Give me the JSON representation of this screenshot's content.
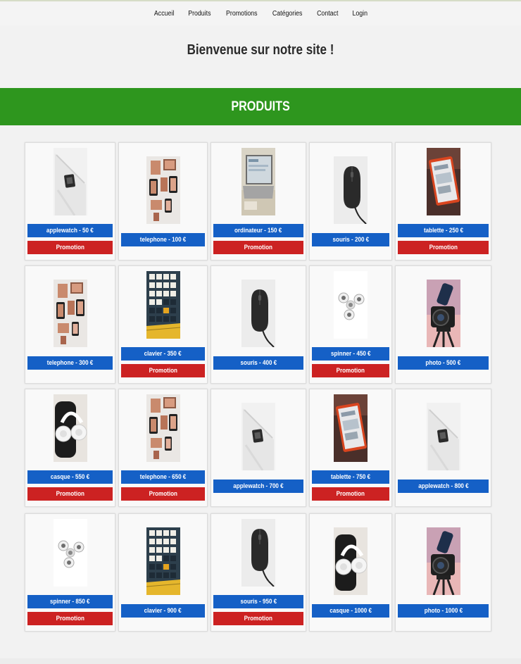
{
  "nav": {
    "items": [
      "Accueil",
      "Produits",
      "Promotions",
      "Catégories",
      "Contact",
      "Login"
    ]
  },
  "welcome": "Bienvenue sur notre site !",
  "banner": "PRODUITS",
  "products": [
    {
      "label": "applewatch - 50 €",
      "image": "applewatch",
      "promo": "Promotion"
    },
    {
      "label": "telephone - 100 €",
      "image": "telephone",
      "promo": ""
    },
    {
      "label": "ordinateur - 150 €",
      "image": "ordinateur",
      "promo": "Promotion"
    },
    {
      "label": "souris - 200 €",
      "image": "souris",
      "promo": ""
    },
    {
      "label": "tablette - 250 €",
      "image": "tablette",
      "promo": "Promotion"
    },
    {
      "label": "telephone - 300 €",
      "image": "telephone",
      "promo": ""
    },
    {
      "label": "clavier - 350 €",
      "image": "clavier",
      "promo": "Promotion"
    },
    {
      "label": "souris - 400 €",
      "image": "souris",
      "promo": ""
    },
    {
      "label": "spinner - 450 €",
      "image": "spinner",
      "promo": "Promotion"
    },
    {
      "label": "photo - 500 €",
      "image": "photo",
      "promo": ""
    },
    {
      "label": "casque - 550 €",
      "image": "casque",
      "promo": "Promotion"
    },
    {
      "label": "telephone - 650 €",
      "image": "telephone",
      "promo": "Promotion"
    },
    {
      "label": "applewatch - 700 €",
      "image": "applewatch",
      "promo": ""
    },
    {
      "label": "tablette - 750 €",
      "image": "tablette",
      "promo": "Promotion"
    },
    {
      "label": "applewatch - 800 €",
      "image": "applewatch",
      "promo": ""
    },
    {
      "label": "spinner - 850 €",
      "image": "spinner",
      "promo": "Promotion"
    },
    {
      "label": "clavier - 900 €",
      "image": "clavier",
      "promo": ""
    },
    {
      "label": "souris - 950 €",
      "image": "souris",
      "promo": "Promotion"
    },
    {
      "label": "casque - 1000 €",
      "image": "casque",
      "promo": ""
    },
    {
      "label": "photo - 1000 €",
      "image": "photo",
      "promo": ""
    }
  ],
  "colors": {
    "banner": "#2e961e",
    "price": "#1560c6",
    "promo": "#cc2222"
  }
}
